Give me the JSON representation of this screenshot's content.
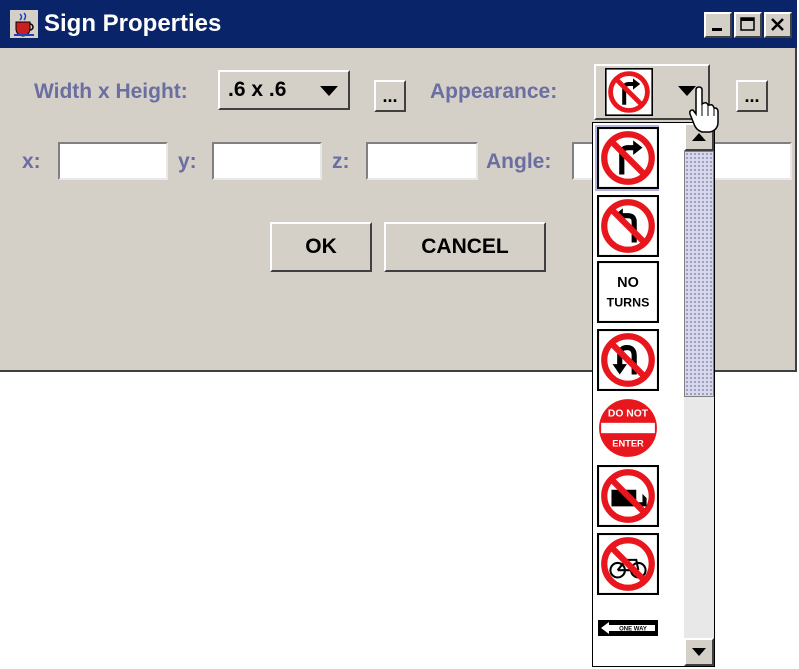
{
  "window": {
    "title": "Sign Properties",
    "app_icon": "java-cup-icon",
    "controls": [
      "minimize-icon",
      "maximize-icon",
      "close-icon"
    ]
  },
  "form": {
    "size_label": "Width x Height:",
    "size_value": ".6 x .6",
    "size_more": "...",
    "appearance_label": "Appearance:",
    "appearance_selected": "no-right-turn",
    "appearance_more": "...",
    "x_label": "x:",
    "x_value": "",
    "y_label": "y:",
    "y_value": "",
    "z_label": "z:",
    "z_value": "",
    "angle_label": "Angle:",
    "angle_value": ""
  },
  "buttons": {
    "ok": "OK",
    "cancel": "CANCEL"
  },
  "dropdown": {
    "items": [
      {
        "icon": "no-right-turn-sign-icon",
        "selected": true
      },
      {
        "icon": "no-left-turn-sign-icon",
        "selected": false
      },
      {
        "icon": "no-turns-sign-icon",
        "text_line1": "NO",
        "text_line2": "TURNS",
        "selected": false
      },
      {
        "icon": "no-u-turn-sign-icon",
        "selected": false
      },
      {
        "icon": "do-not-enter-sign-icon",
        "text_line1": "DO NOT",
        "text_line2": "ENTER",
        "selected": false
      },
      {
        "icon": "no-trucks-sign-icon",
        "selected": false
      },
      {
        "icon": "no-bicycles-sign-icon",
        "selected": false
      },
      {
        "icon": "one-way-sign-icon",
        "text_line1": "ONE WAY",
        "selected": false
      }
    ]
  },
  "colors": {
    "titlebar": "#0a246a",
    "label": "#6b6ea0",
    "sign_red": "#e8171d",
    "selection": "#b4b4dc"
  }
}
